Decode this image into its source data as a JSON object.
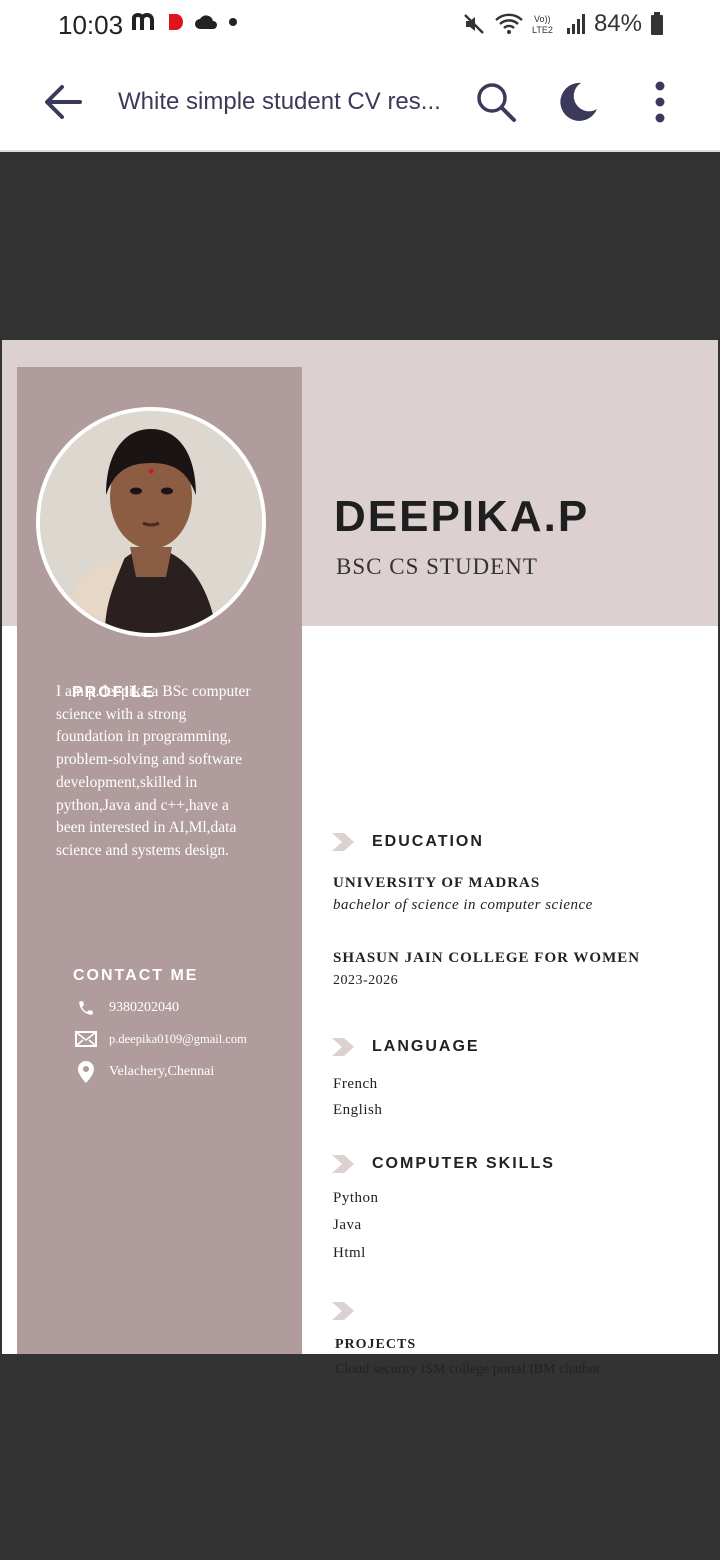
{
  "status_bar": {
    "time": "10:03",
    "battery": "84%"
  },
  "toolbar": {
    "title": "White simple student CV res..."
  },
  "resume": {
    "name": "DEEPIKA.P",
    "subtitle": "BSC CS STUDENT",
    "profile_heading": "PROFILE",
    "profile_text": "I am p.deepika,a BSc computer science with a strong foundation in programming, problem-solving and software development,skilled in python,Java and c++,have a been interested in AI,Ml,data science and systems design.",
    "contact_heading": "CONTACT ME",
    "contacts": {
      "phone": "9380202040",
      "email": "p.deepika0109@gmail.com",
      "location": "Velachery,Chennai"
    },
    "education_heading": "EDUCATION",
    "education": [
      {
        "school": "UNIVERSITY OF MADRAS",
        "detail": "bachelor of science in computer science"
      },
      {
        "school": "SHASUN JAIN COLLEGE FOR WOMEN",
        "detail": "2023-2026"
      }
    ],
    "language_heading": "LANGUAGE",
    "languages": [
      "French",
      "English"
    ],
    "skills_heading": "COMPUTER SKILLS",
    "skills": [
      "Python",
      "Java",
      "Html"
    ],
    "projects_heading": "PROJECTS",
    "projects_text": "Cloud security ISM college portal IBM chatbot"
  },
  "colors": {
    "accent": "#3b3a5a",
    "sidebar": "#b19c9d",
    "header_band": "#ddd0d1",
    "viewer_bg": "#333333"
  }
}
